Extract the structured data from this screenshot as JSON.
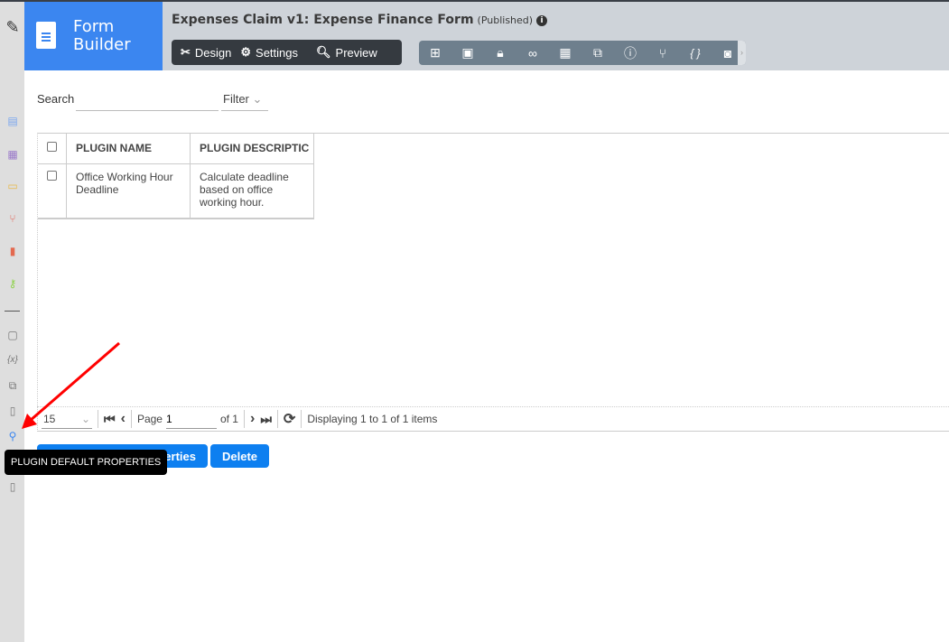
{
  "brand": {
    "line1": "Form",
    "line2": "Builder"
  },
  "header": {
    "title": "Expenses Claim v1: Expense Finance Form",
    "status": "(Published)"
  },
  "modes": [
    {
      "label": "Design",
      "icon": "design-icon"
    },
    {
      "label": "Settings",
      "icon": "gear-icon"
    },
    {
      "label": "Preview",
      "icon": "preview-icon"
    }
  ],
  "tools": [
    "sitemap-icon",
    "form-icon",
    "lock-icon",
    "binoculars-icon",
    "table-icon",
    "language-icon",
    "help-icon",
    "branch-icon",
    "json-icon",
    "camera-icon"
  ],
  "sidebar": [
    "form-icon",
    "datalist-icon",
    "userview-icon",
    "process-icon",
    "report-icon",
    "api-key-icon",
    "note-icon",
    "variable-icon",
    "language-icon",
    "pdf-icon",
    "plugin-icon",
    "script-icon"
  ],
  "search": {
    "label": "Search",
    "value": "",
    "filter": "Filter"
  },
  "table": {
    "headers": [
      "PLUGIN NAME",
      "PLUGIN DESCRIPTIC"
    ],
    "rows": [
      {
        "name_l1": "Office Working Hour",
        "name_l2": "Deadline",
        "desc_l1": "Calculate deadline",
        "desc_l2": "based on office",
        "desc_l3": "working hour."
      }
    ]
  },
  "pager": {
    "page_size": "15",
    "page_label": "Page",
    "page": "1",
    "of": "of 1",
    "display": "Displaying 1 to 1 of 1 items"
  },
  "buttons": {
    "properties": "perties",
    "delete": "Delete"
  },
  "tooltip": "PLUGIN DEFAULT PROPERTIES",
  "colors": {
    "brand": "#3b86f0",
    "button": "#0d7ff0",
    "arrow": "#ff0000"
  }
}
